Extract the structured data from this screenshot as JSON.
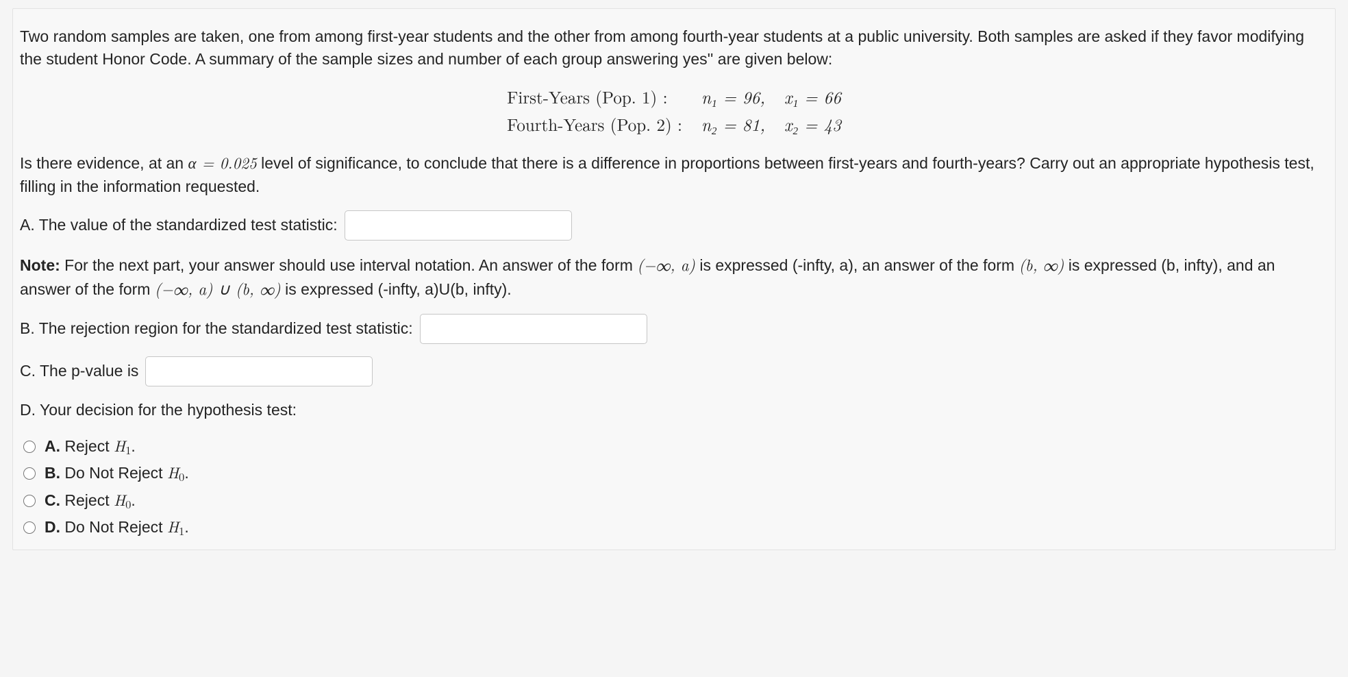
{
  "intro_p1": "Two random samples are taken, one from among first-year students and the other from among fourth-year students at a public university. Both samples are asked if they favor modifying the student Honor Code. A summary of the sample sizes and number of each group answering yes'' are given below:",
  "data_block": {
    "row1_label": "First-Years (Pop. 1) :",
    "row1_n": "n₁ = 96,",
    "row1_x": "x₁ = 66",
    "row2_label": "Fourth-Years (Pop. 2) :",
    "row2_n": "n₂ = 81,",
    "row2_x": "x₂ = 43"
  },
  "question_p2_pre": "Is there evidence, at an ",
  "question_alpha": "α = 0.025",
  "question_p2_post": " level of significance, to conclude that there is a difference in proportions between first-years and fourth-years? Carry out an appropriate hypothesis test, filling in the information requested.",
  "partA_label": "A. The value of the standardized test statistic:",
  "note_bold": "Note:",
  "note_text_1": " For the next part, your answer should use interval notation. An answer of the form ",
  "note_int1": "(−∞, a)",
  "note_text_2": " is expressed (-infty, a), an answer of the form ",
  "note_int2": "(b, ∞)",
  "note_text_3": " is expressed (b, infty), and an answer of the form ",
  "note_int3": "(−∞, a) ∪ (b, ∞)",
  "note_text_4": " is expressed (-infty, a)U(b, infty).",
  "partB_label": "B. The rejection region for the standardized test statistic:",
  "partC_label": "C. The p-value is",
  "partD_label": "D. Your decision for the hypothesis test:",
  "options": {
    "a_bold": "A.",
    "a_text": " Reject ",
    "a_h": "H",
    "a_sub": "1",
    "b_bold": "B.",
    "b_text": " Do Not Reject ",
    "b_h": "H",
    "b_sub": "0",
    "c_bold": "C.",
    "c_text": " Reject ",
    "c_h": "H",
    "c_sub": "0",
    "d_bold": "D.",
    "d_text": " Do Not Reject ",
    "d_h": "H",
    "d_sub": "1"
  },
  "period": "."
}
